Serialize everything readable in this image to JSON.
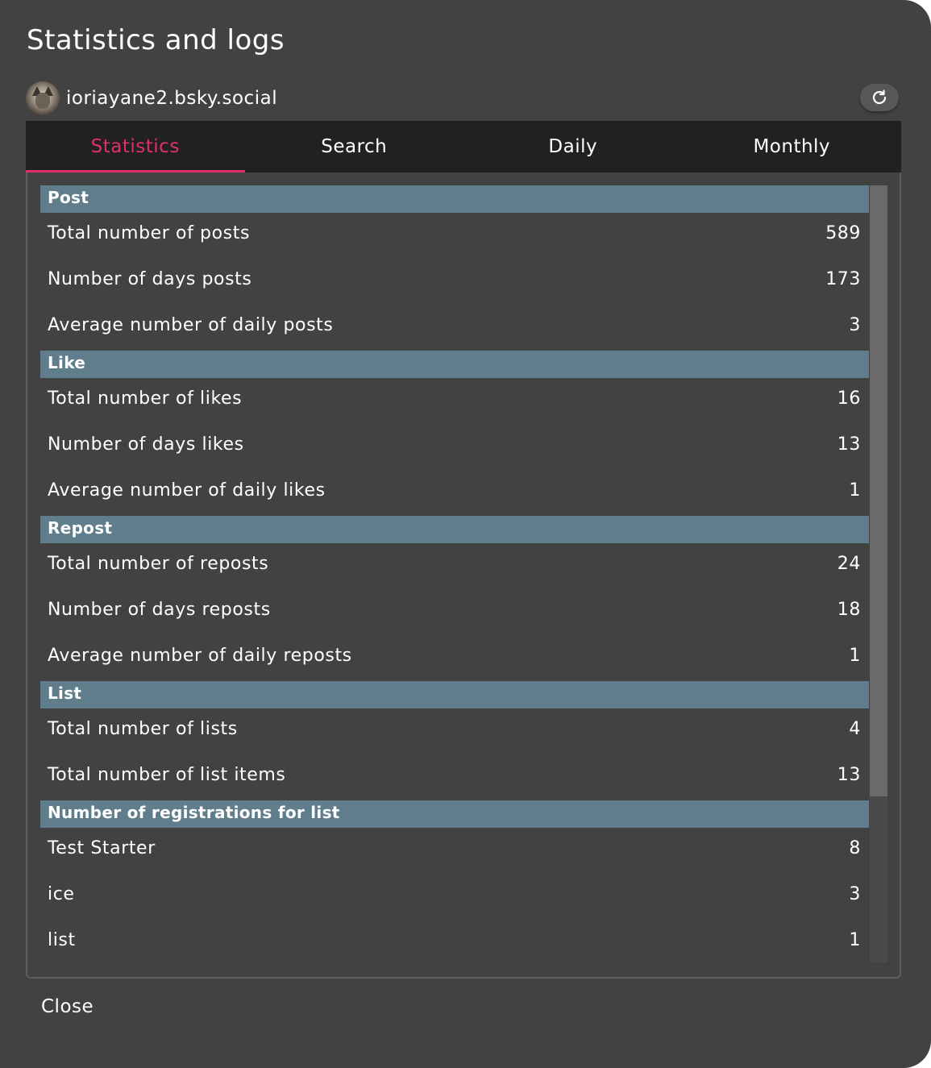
{
  "dialog": {
    "title": "Statistics and logs",
    "account": "ioriayane2.bsky.social",
    "refresh_icon": "refresh-icon",
    "close_label": "Close"
  },
  "tabs": [
    {
      "label": "Statistics",
      "active": true
    },
    {
      "label": "Search",
      "active": false
    },
    {
      "label": "Daily",
      "active": false
    },
    {
      "label": "Monthly",
      "active": false
    }
  ],
  "colors": {
    "accent": "#e0306a",
    "section_header": "#607d8b",
    "background": "#424242",
    "tab_bar": "#212121"
  },
  "sections": [
    {
      "title": "Post",
      "rows": [
        {
          "label": "Total number of posts",
          "value": "589"
        },
        {
          "label": "Number of days posts",
          "value": "173"
        },
        {
          "label": "Average number of daily posts",
          "value": "3"
        }
      ]
    },
    {
      "title": "Like",
      "rows": [
        {
          "label": "Total number of likes",
          "value": "16"
        },
        {
          "label": "Number of days likes",
          "value": "13"
        },
        {
          "label": "Average number of daily likes",
          "value": "1"
        }
      ]
    },
    {
      "title": "Repost",
      "rows": [
        {
          "label": "Total number of reposts",
          "value": "24"
        },
        {
          "label": "Number of days reposts",
          "value": "18"
        },
        {
          "label": "Average number of daily reposts",
          "value": "1"
        }
      ]
    },
    {
      "title": "List",
      "rows": [
        {
          "label": "Total number of lists",
          "value": "4"
        },
        {
          "label": "Total number of list items",
          "value": "13"
        }
      ]
    },
    {
      "title": "Number of registrations for list",
      "rows": [
        {
          "label": "Test Starter",
          "value": "8"
        },
        {
          "label": "ice",
          "value": "3"
        },
        {
          "label": "list",
          "value": "1"
        }
      ]
    }
  ]
}
